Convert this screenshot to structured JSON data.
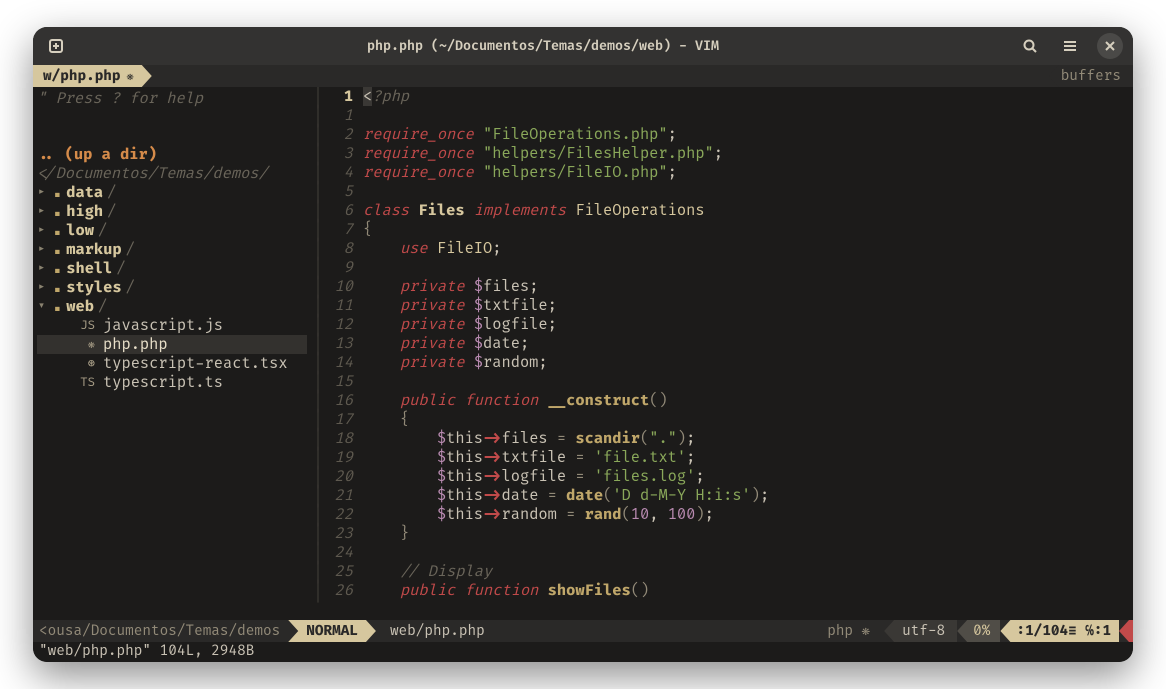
{
  "titlebar": {
    "title": "php.php (~/Documentos/Temas/demos/web) - VIM"
  },
  "tabbar": {
    "tab_label": "w/php.php",
    "tab_marker": "❋",
    "buffers_label": "buffers"
  },
  "nerdtree": {
    "help": "\" Press ? for help",
    "updir": ".. (up a dir)",
    "root": "</Documentos/Temas/demos/",
    "folders": [
      {
        "name": "data",
        "expanded": false
      },
      {
        "name": "high",
        "expanded": false
      },
      {
        "name": "low",
        "expanded": false
      },
      {
        "name": "markup",
        "expanded": false
      },
      {
        "name": "shell",
        "expanded": false
      },
      {
        "name": "styles",
        "expanded": false
      },
      {
        "name": "web",
        "expanded": true
      }
    ],
    "web_files": [
      {
        "icon": "JS",
        "name": "javascript.js",
        "selected": false
      },
      {
        "icon": "❋",
        "name": "php.php",
        "selected": true
      },
      {
        "icon": "⊛",
        "name": "typescript-react.tsx",
        "selected": false
      },
      {
        "icon": "TS",
        "name": "typescript.ts",
        "selected": false
      }
    ]
  },
  "code": {
    "current_line": 1,
    "lines": [
      {
        "n": 1,
        "html": "<span class='tag-open'>&lt;</span><span class='php-tag'>?php</span>"
      },
      {
        "n": 1,
        "html": ""
      },
      {
        "n": 2,
        "html": "<span class='kw-red'>require_once</span> <span class='str'>\"FileOperations.php\"</span><span class='punc'>;</span>"
      },
      {
        "n": 3,
        "html": "<span class='kw-red'>require_once</span> <span class='str'>\"helpers/FilesHelper.php\"</span><span class='punc'>;</span>"
      },
      {
        "n": 4,
        "html": "<span class='kw-red'>require_once</span> <span class='str'>\"helpers/FileIO.php\"</span><span class='punc'>;</span>"
      },
      {
        "n": 5,
        "html": ""
      },
      {
        "n": 6,
        "html": "<span class='kw-red'>class</span> <span class='cls'>Files</span> <span class='kw-red'>implements</span> <span class='type'>FileOperations</span>"
      },
      {
        "n": 7,
        "html": "<span class='brace'>{</span>"
      },
      {
        "n": 8,
        "html": "    <span class='use-kw'>use</span> <span class='type'>FileIO</span><span class='punc'>;</span>"
      },
      {
        "n": 9,
        "html": ""
      },
      {
        "n": 10,
        "html": "    <span class='mod'>private</span> <span class='dollar'>$</span><span class='var'>files</span><span class='punc'>;</span>"
      },
      {
        "n": 11,
        "html": "    <span class='mod'>private</span> <span class='dollar'>$</span><span class='var'>txtfile</span><span class='punc'>;</span>"
      },
      {
        "n": 12,
        "html": "    <span class='mod'>private</span> <span class='dollar'>$</span><span class='var'>logfile</span><span class='punc'>;</span>"
      },
      {
        "n": 13,
        "html": "    <span class='mod'>private</span> <span class='dollar'>$</span><span class='var'>date</span><span class='punc'>;</span>"
      },
      {
        "n": 14,
        "html": "    <span class='mod'>private</span> <span class='dollar'>$</span><span class='var'>random</span><span class='punc'>;</span>"
      },
      {
        "n": 15,
        "html": ""
      },
      {
        "n": 16,
        "html": "    <span class='mod'>public</span> <span class='func-kw'>function</span> <span class='func-name'>__construct</span><span class='paren'>()</span>"
      },
      {
        "n": 17,
        "html": "    <span class='brace'>{</span>"
      },
      {
        "n": 18,
        "html": "        <span class='dollar'>$</span><span class='var'>this</span><span class='arrow-op'>-&gt;</span><span class='var'>files</span> <span class='eq'>=</span> <span class='call'>scandir</span><span class='paren'>(</span><span class='str'>\".\"</span><span class='paren'>)</span><span class='punc'>;</span>"
      },
      {
        "n": 19,
        "html": "        <span class='dollar'>$</span><span class='var'>this</span><span class='arrow-op'>-&gt;</span><span class='var'>txtfile</span> <span class='eq'>=</span> <span class='str2'>'file.txt'</span><span class='punc'>;</span>"
      },
      {
        "n": 20,
        "html": "        <span class='dollar'>$</span><span class='var'>this</span><span class='arrow-op'>-&gt;</span><span class='var'>logfile</span> <span class='eq'>=</span> <span class='str2'>'files.log'</span><span class='punc'>;</span>"
      },
      {
        "n": 21,
        "html": "        <span class='dollar'>$</span><span class='var'>this</span><span class='arrow-op'>-&gt;</span><span class='var'>date</span> <span class='eq'>=</span> <span class='call'>date</span><span class='paren'>(</span><span class='str2'>'D d-M-Y H:i:s'</span><span class='paren'>)</span><span class='punc'>;</span>"
      },
      {
        "n": 22,
        "html": "        <span class='dollar'>$</span><span class='var'>this</span><span class='arrow-op'>-&gt;</span><span class='var'>random</span> <span class='eq'>=</span> <span class='call'>rand</span><span class='paren'>(</span><span class='num'>10</span><span class='punc'>,</span> <span class='num'>100</span><span class='paren'>)</span><span class='punc'>;</span>"
      },
      {
        "n": 23,
        "html": "    <span class='brace'>}</span>"
      },
      {
        "n": 24,
        "html": ""
      },
      {
        "n": 25,
        "html": "    <span class='comment-i'>// Display</span>"
      },
      {
        "n": 26,
        "html": "    <span class='mod'>public</span> <span class='func-kw'>function</span> <span class='func-name'>showFiles</span><span class='paren'>()</span>"
      }
    ]
  },
  "statusline": {
    "left_path": "<ousa/Documentos/Temas/demos",
    "mode": "NORMAL",
    "file": "web/php.php",
    "filetype": "php ❋",
    "encoding": "utf-8 ",
    "percent": "0%",
    "position": ":1/104≡ ℅:1"
  },
  "cmdline": "\"web/php.php\" 104L, 2948B"
}
